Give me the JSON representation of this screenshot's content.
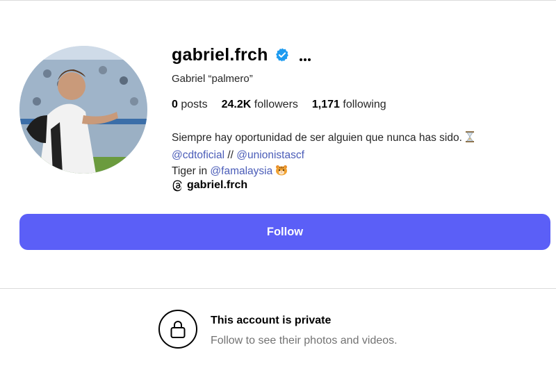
{
  "profile": {
    "username": "gabriel.frch",
    "full_name": "Gabriel “palmero”",
    "verified": true
  },
  "stats": {
    "posts_count": "0",
    "posts_label": "posts",
    "followers_count": "24.2K",
    "followers_label": "followers",
    "following_count": "1,171",
    "following_label": "following"
  },
  "bio": {
    "line1": "Siempre hay oportunidad de ser alguien que nunca has sido.",
    "line1_emoji": "hourglass-icon",
    "mention1": "@cdtoficial",
    "separator": "//",
    "mention2": "@unionistascf",
    "line3_prefix": "Tiger in",
    "mention3": "@famalaysia",
    "line3_emoji": "tiger-face-icon",
    "threads_handle": "gabriel.frch"
  },
  "follow_button": {
    "label": "Follow",
    "color": "#5b5ff7"
  },
  "private_notice": {
    "title": "This account is private",
    "subtitle": "Follow to see their photos and videos."
  },
  "colors": {
    "link": "#4a5cb8",
    "verified": "#1d9bf0",
    "muted": "#737373"
  }
}
